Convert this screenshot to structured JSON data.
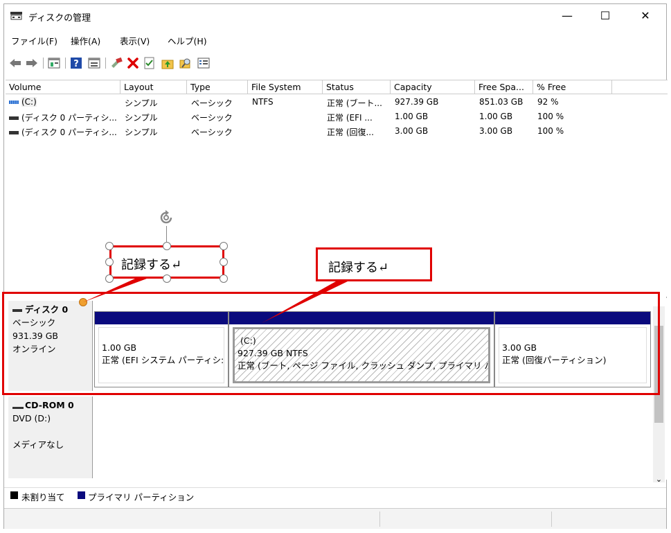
{
  "window": {
    "title": "ディスクの管理",
    "minimize": "—",
    "maximize": "☐",
    "close": "✕"
  },
  "menu": [
    "ファイル(F)",
    "操作(A)",
    "表示(V)",
    "ヘルプ(H)"
  ],
  "toolbar_icons": [
    "back-icon",
    "forward-icon",
    "properties-icon",
    "help-icon",
    "view-icon",
    "connect-icon",
    "delete-icon",
    "check-icon",
    "up-icon",
    "search-icon",
    "list-icon"
  ],
  "volume_list": {
    "columns": [
      "Volume",
      "Layout",
      "Type",
      "File System",
      "Status",
      "Capacity",
      "Free Spa...",
      "% Free"
    ],
    "rows": [
      {
        "volume": "(C:)",
        "layout": "シンプル",
        "type": "ベーシック",
        "fs": "NTFS",
        "status": "正常 (ブート...",
        "capacity": "927.39 GB",
        "free": "851.03 GB",
        "pct": "92 %"
      },
      {
        "volume": "(ディスク 0 パーティシ...",
        "layout": "シンプル",
        "type": "ベーシック",
        "fs": "",
        "status": "正常 (EFI ...",
        "capacity": "1.00 GB",
        "free": "1.00 GB",
        "pct": "100 %"
      },
      {
        "volume": "(ディスク 0 パーティシ...",
        "layout": "シンプル",
        "type": "ベーシック",
        "fs": "",
        "status": "正常 (回復...",
        "capacity": "3.00 GB",
        "free": "3.00 GB",
        "pct": "100 %"
      }
    ]
  },
  "disks": {
    "disk0": {
      "name": "ディスク 0",
      "type": "ベーシック",
      "size": "931.39 GB",
      "state": "オンライン",
      "partitions": [
        {
          "label": "",
          "size": "1.00 GB",
          "status": "正常 (EFI システム パーティシ:"
        },
        {
          "label": "(C:)",
          "size": "927.39 GB NTFS",
          "status": "正常 (ブート, ページ ファイル, クラッシュ ダンプ, プライマリ パーテ"
        },
        {
          "label": "",
          "size": "3.00 GB",
          "status": "正常 (回復パーティション)"
        }
      ]
    },
    "cdrom0": {
      "name": "CD-ROM 0",
      "drive": "DVD (D:)",
      "media": "メディアなし"
    }
  },
  "legend": {
    "unallocated": "未割り当て",
    "primary": "プライマリ パーティション"
  },
  "annotations": {
    "left_note": "記録する↵",
    "right_note": "記録する↵"
  },
  "colors": {
    "accent_red": "#e00000",
    "partition_bar": "#0a0a7d",
    "unallocated": "#000000"
  }
}
